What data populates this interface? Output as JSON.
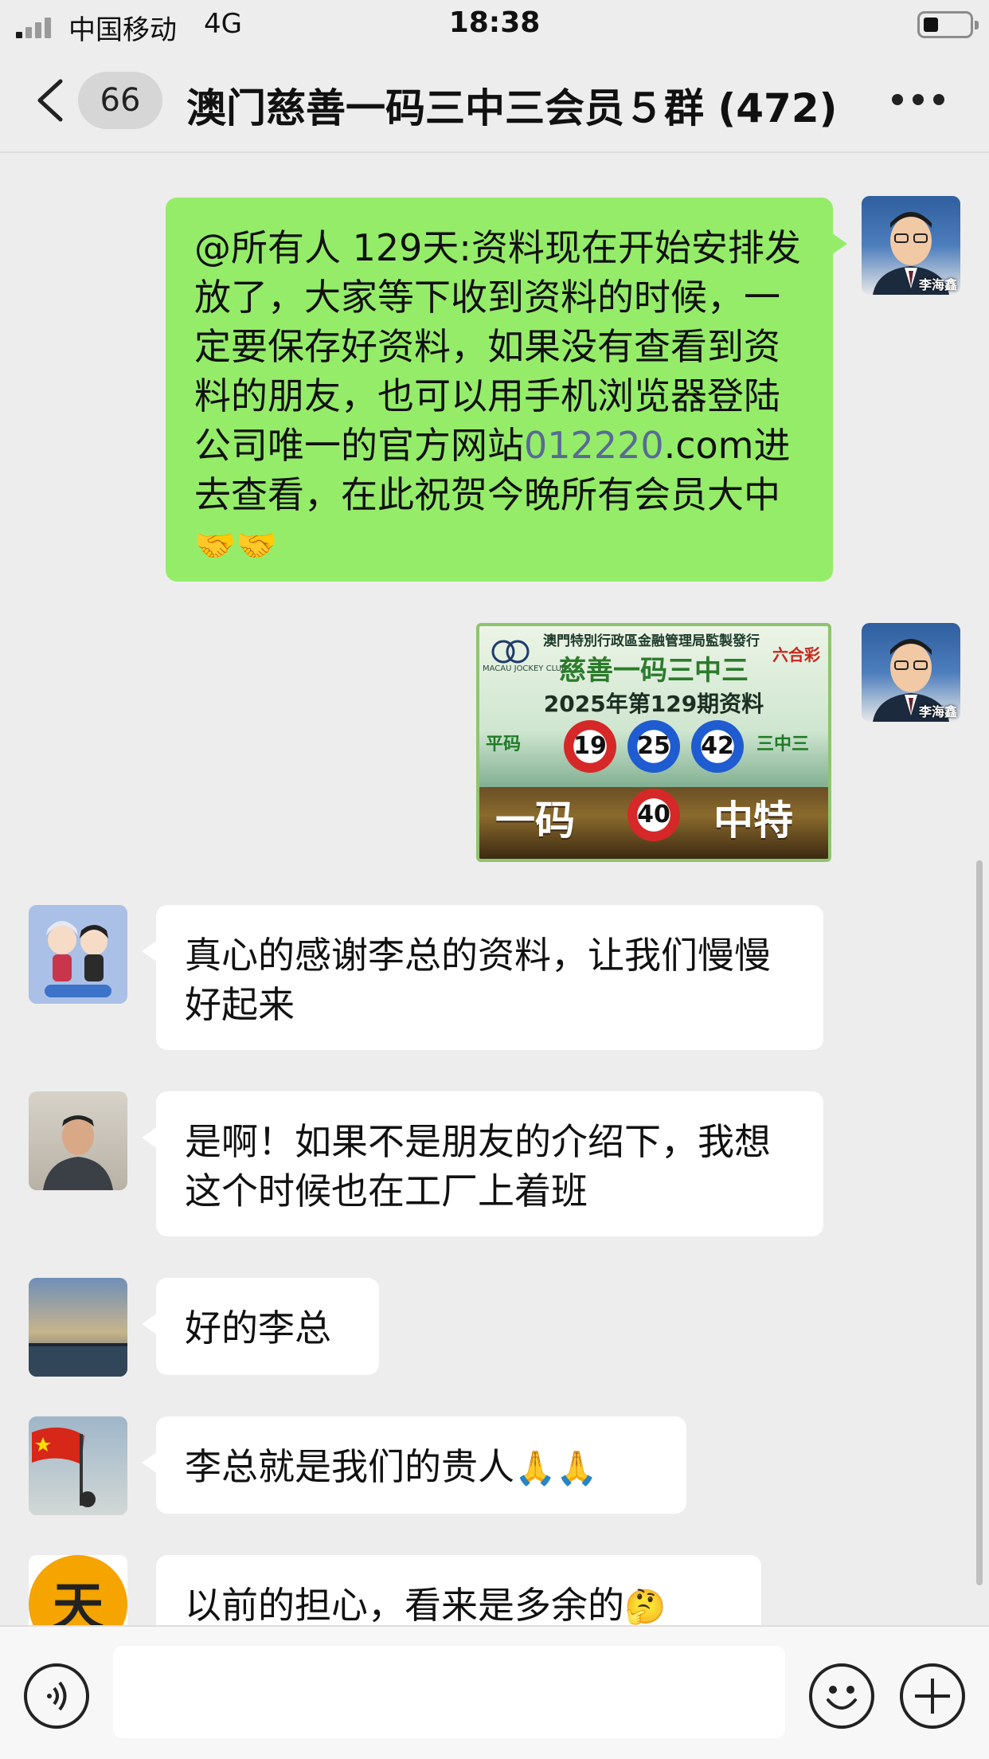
{
  "status_bar": {
    "carrier": "中国移动",
    "network": "4G",
    "time": "18:38"
  },
  "nav": {
    "unread_count": "66",
    "title": "澳门慈善一码三中三会员５群 (472)"
  },
  "messages": [
    {
      "sender_tag": "李海鑫",
      "text_before_link": "@所有人 129天:资料现在开始安排发放了，大家等下收到资料的时候，一定要保存好资料，如果没有查看到资料的朋友，也可以用手机浏览器登陆公司唯一的官方网站",
      "link": "012220",
      "text_after_link": ".com进去查看，在此祝贺今晚所有会员大中",
      "emoji": "🤝🤝"
    },
    {
      "sender_tag": "李海鑫",
      "poster": {
        "header": "澳門特別行政區金融管理局監製發行",
        "logo_text": "MACAU JOCKEY CLUB",
        "brand": "六合彩",
        "title": "慈善一码三中三",
        "subtitle": "2025年第129期资料",
        "label_left": "平码",
        "label_right": "三中三",
        "balls": [
          "19",
          "25",
          "42"
        ],
        "special_ball": "40",
        "bottom_left": "一码",
        "bottom_right": "中特"
      }
    },
    {
      "text": "真心的感谢李总的资料，让我们慢慢好起来"
    },
    {
      "text": "是啊！如果不是朋友的介绍下，我想这个时候也在工厂上着班"
    },
    {
      "text": "好的李总"
    },
    {
      "text": "李总就是我们的贵人",
      "emoji": "🙏🙏"
    },
    {
      "text": "以前的担心，看来是多余的",
      "emoji": "🤔",
      "avatar_char": "天"
    }
  ],
  "colors": {
    "mine_bubble": "#95ec69",
    "other_bubble": "#ffffff",
    "background": "#ededed",
    "link": "#576b95"
  }
}
